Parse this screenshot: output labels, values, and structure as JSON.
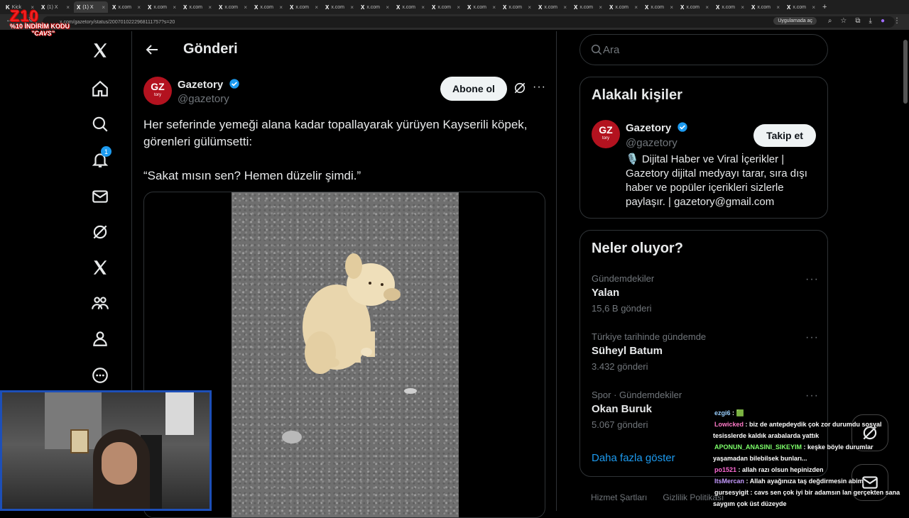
{
  "browser": {
    "tabs": [
      {
        "icon": "K",
        "label": "Kick"
      },
      {
        "icon": "X",
        "label": "(1) X"
      },
      {
        "icon": "X",
        "label": "(1) X"
      },
      {
        "icon": "X",
        "label": "x.com"
      },
      {
        "icon": "X",
        "label": "x.com"
      },
      {
        "icon": "X",
        "label": "x.com"
      },
      {
        "icon": "X",
        "label": "x.com"
      },
      {
        "icon": "X",
        "label": "x.com"
      },
      {
        "icon": "X",
        "label": "x.com"
      },
      {
        "icon": "X",
        "label": "x.com"
      },
      {
        "icon": "X",
        "label": "x.com"
      },
      {
        "icon": "X",
        "label": "x.com"
      },
      {
        "icon": "X",
        "label": "x.com"
      },
      {
        "icon": "X",
        "label": "x.com"
      },
      {
        "icon": "X",
        "label": "x.com"
      },
      {
        "icon": "X",
        "label": "x.com"
      },
      {
        "icon": "X",
        "label": "x.com"
      },
      {
        "icon": "X",
        "label": "x.com"
      },
      {
        "icon": "X",
        "label": "x.com"
      },
      {
        "icon": "X",
        "label": "x.com"
      },
      {
        "icon": "X",
        "label": "x.com"
      },
      {
        "icon": "X",
        "label": "x.com"
      },
      {
        "icon": "X",
        "label": "x.com"
      }
    ],
    "url": "x.com/gazetory/status/2007010222968111757?s=20",
    "open_app": "Uygulamada aç"
  },
  "overlay": {
    "logo_big": "Z10",
    "logo_small": "%10 İNDİRİM KODU",
    "code": "\"CAVS\""
  },
  "nav": {
    "notification_count": "1"
  },
  "post": {
    "header_title": "Gönderi",
    "author_name": "Gazetory",
    "author_handle": "@gazetory",
    "avatar_text": "GZ",
    "avatar_sub": "tory",
    "subscribe_label": "Abone ol",
    "text": "Her seferinde yemeği alana kadar topallayarak yürüyen Kayserili köpek, görenleri gülümsetti:\n\n“Sakat mısın sen? Hemen düzelir şimdi.”"
  },
  "search": {
    "placeholder": "Ara"
  },
  "related": {
    "title": "Alakalı kişiler",
    "name": "Gazetory",
    "handle": "@gazetory",
    "follow_label": "Takip et",
    "bio": "🎙️ Dijital Haber ve Viral İçerikler | Gazetory dijital medyayı tarar, sıra dışı haber ve popüler içerikleri sizlerle paylaşır. | gazetory@gmail.com"
  },
  "trends": {
    "title": "Neler oluyor?",
    "items": [
      {
        "context": "Gündemdekiler",
        "name": "Yalan",
        "count": "15,6 B gönderi"
      },
      {
        "context": "Türkiye tarihinde gündemde",
        "name": "Süheyl Batum",
        "count": "3.432 gönderi"
      },
      {
        "context": "Spor · Gündemdekiler",
        "name": "Okan Buruk",
        "count": "5.067 gönderi"
      }
    ],
    "show_more": "Daha fazla göster"
  },
  "footer": {
    "terms": "Hizmet Şartları",
    "privacy": "Gizlilik Politikası"
  },
  "chat": {
    "messages": [
      {
        "user": "ezgi6",
        "color": "#9ad0ff",
        "text": "🟩"
      },
      {
        "user": "Lowicked",
        "color": "#ff7ac8",
        "text": "biz de antepdeydik çok zor durumdu sosyal tesisslerde kaldık arabalarda yattık"
      },
      {
        "user": "APONUN_ANASINI_SIKEYIM",
        "color": "#7dff6a",
        "text": "keşke böyle durumlar yaşamadan bilebilsek bunları..."
      },
      {
        "user": "po1521",
        "color": "#ff6ad5",
        "text": "allah razı olsun hepinizden"
      },
      {
        "user": "ItsMercan",
        "color": "#c59bff",
        "text": "Allah ayağınıza taş değdirmesin abim"
      },
      {
        "user": "gursesyigit",
        "color": "#ffffff",
        "text": "cavs sen çok iyi bir adamsın lan gerçekten sana saygım çok üst düzeyde"
      }
    ]
  },
  "colors": {
    "accent": "#1d9bf0",
    "background": "#000000",
    "border": "#2f3336",
    "muted": "#71767b"
  }
}
